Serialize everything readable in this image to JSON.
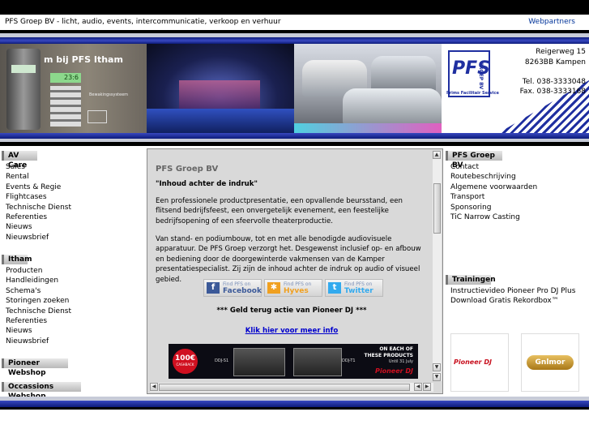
{
  "header": {
    "site_title": "PFS Groep BV - licht, audio, events, intercommunicatie, verkoop en verhuur",
    "webpartners_link": "Webpartners"
  },
  "banner": {
    "slogan": "m bij PFS Itham",
    "device_display": "23:6",
    "device_small_text": "Bewakingssysteem",
    "logo_text": "PFS",
    "logo_side": "GROEP BV",
    "logo_tagline": "Prims Facilitair Service",
    "address_street": "Reigerweg 15",
    "address_city": "8263BB Kampen",
    "phone": "Tel. 038-3333048",
    "fax": "Fax. 038-3333168"
  },
  "left_nav": {
    "av_care": {
      "heading": "AV Care",
      "items": [
        "Sales",
        "Rental",
        "Events & Regie",
        "Flightcases",
        "Technische Dienst",
        "Referenties",
        "Nieuws",
        "Nieuwsbrief"
      ]
    },
    "itham": {
      "heading": "Itham",
      "items": [
        "Producten",
        "Handleidingen",
        "Schema's",
        "Storingen zoeken",
        "Technische Dienst",
        "Referenties",
        "Nieuws",
        "Nieuwsbrief"
      ]
    },
    "pioneer_webshop": {
      "heading": "Pioneer Webshop"
    },
    "occassions_webshop": {
      "heading": "Occassions Webshop"
    }
  },
  "content": {
    "title": "PFS Groep BV",
    "subtitle": "\"Inhoud achter de indruk\"",
    "paragraph1": "Een professionele productpresentatie, een opvallende beursstand, een flitsend bedrijfsfeest, een onvergetelijk evenement, een feestelijke bedrijfsopening of een sfeervolle theaterproductie.",
    "paragraph2": "Van stand- en podiumbouw, tot en met alle benodigde audiovisuele apparatuur. De PFS Groep verzorgt het. Desgewenst inclusief op- en afbouw en bediening door de doorgewinterde vakmensen van de Kamper presentatiespecialist. Zij zijn de inhoud achter de indruk op audio of visueel gebied.",
    "social": [
      {
        "small": "Find PFS on",
        "name": "Facebook",
        "color": "#3b5998"
      },
      {
        "small": "Find PFS on",
        "name": "Hyves",
        "color": "#f0a020"
      },
      {
        "small": "Find PFS on",
        "name": "Twitter",
        "color": "#33aaee"
      }
    ],
    "promo_heading": "*** Geld terug actie van Pioneer DJ ***",
    "promo_link": "Klik hier voor meer info",
    "promo_banner": {
      "cashback_amount": "100€",
      "cashback_label": "CASHBACK",
      "product1": "DDJ-S1",
      "product2": "DDJ-T1",
      "offer_line1": "ON EACH OF",
      "offer_line2": "THESE PRODUCTS",
      "offer_line3": "Until 31 July",
      "brand": "Pioneer DJ"
    }
  },
  "right_nav": {
    "pfs_groep": {
      "heading": "PFS Groep BV",
      "items": [
        "Contact",
        "Routebeschrijving",
        "Algemene voorwaarden",
        "Transport",
        "Sponsoring",
        "TiC Narrow Casting"
      ]
    },
    "trainingen": {
      "heading": "Trainingen",
      "items": [
        "Instructievideo Pioneer Pro DJ Plus",
        "Download Gratis Rekordbox™"
      ]
    },
    "logos": [
      "Pioneer DJ",
      "Gnlmor"
    ]
  },
  "colors": {
    "accent_blue": "#1f2fa0",
    "link_blue": "#003399",
    "content_bg": "#d9d9d9"
  }
}
